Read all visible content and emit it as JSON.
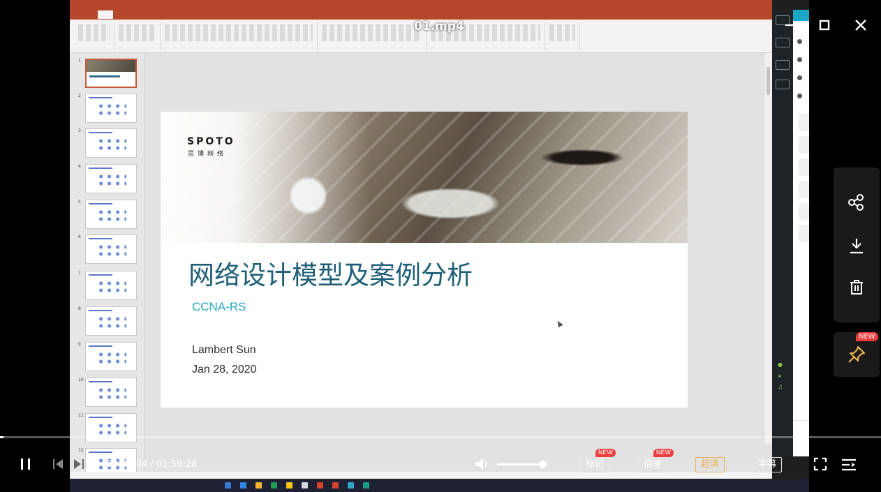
{
  "player": {
    "file_name": "01.mp4",
    "current_time": "00:00:04",
    "separator": " / ",
    "duration": "01:59:28",
    "playback_progress": 0.0006,
    "volume_level": 0.9,
    "buttons": {
      "mark": "标记",
      "speed": "倍速",
      "quality": "超清",
      "subtitle": "字幕"
    },
    "new_badge": "NEW",
    "colors": {
      "accent_badge": "#ee3d3d",
      "quality_selected": "#e8b45a"
    }
  },
  "side_actions": {
    "icons": [
      "share-icon",
      "download-icon",
      "delete-icon",
      "pin-icon"
    ],
    "pin_badge": "NEW"
  },
  "window_controls": {
    "icons": [
      "minimize-icon",
      "maximize-icon",
      "close-icon"
    ]
  },
  "video_frame": {
    "slide": {
      "brand": "SPOTO",
      "brand_sub": "思博网络",
      "title": "网络设计模型及案例分析",
      "subtitle": "CCNA-RS",
      "author": "Lambert Sun",
      "date": "Jan 28, 2020"
    },
    "thumbnail_numbers": [
      "1",
      "2",
      "3",
      "4",
      "5",
      "6",
      "7",
      "8",
      "9",
      "10",
      "11",
      "12"
    ],
    "colors": {
      "powerpoint_red": "#b7472a",
      "title_teal": "#1f5f78",
      "subtitle_cyan": "#23a7c4",
      "chat_accent": "#1ba8c6"
    }
  }
}
